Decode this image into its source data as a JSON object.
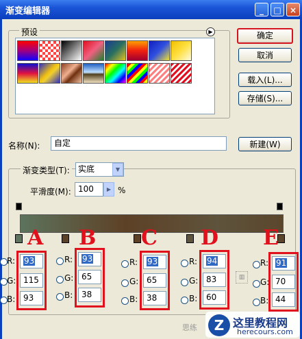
{
  "window": {
    "title": "渐变编辑器"
  },
  "presets": {
    "label": "预设",
    "swatches_row1": [
      "red-blue",
      "transparent-red",
      "black-white",
      "red-green",
      "blue-yellow",
      "orange-red",
      "blue-yellow-2",
      "yellow"
    ],
    "swatches_row2": [
      "blue-red-yellow",
      "blue-yellow-3",
      "copper",
      "chrome",
      "rainbow",
      "rainbow-diag",
      "transparent-stripes",
      "red-stripes"
    ]
  },
  "buttons": {
    "ok": "确定",
    "cancel": "取消",
    "load": "载入(L)...",
    "save": "存储(S)...",
    "new": "新建(W)"
  },
  "name": {
    "label": "名称(N):",
    "value": "自定"
  },
  "gradient": {
    "type_label": "渐变类型(T):",
    "type_value": "实底",
    "smooth_label": "平滑度(M):",
    "smooth_value": "100",
    "smooth_unit": "%"
  },
  "panels": [
    {
      "letter": "A",
      "r": "93",
      "g": "115",
      "b": "93"
    },
    {
      "letter": "B",
      "r": "93",
      "g": "65",
      "b": "38"
    },
    {
      "letter": "C",
      "r": "93",
      "g": "65",
      "b": "38"
    },
    {
      "letter": "D",
      "r": "94",
      "g": "83",
      "b": "60"
    },
    {
      "letter": "E",
      "r": "91",
      "g": "70",
      "b": "44"
    }
  ],
  "channel_labels": {
    "r": "R:",
    "g": "G:",
    "b": "B:"
  },
  "watermark": {
    "name": "这里教程网",
    "url": "herecours.com",
    "left_text": "思练"
  }
}
